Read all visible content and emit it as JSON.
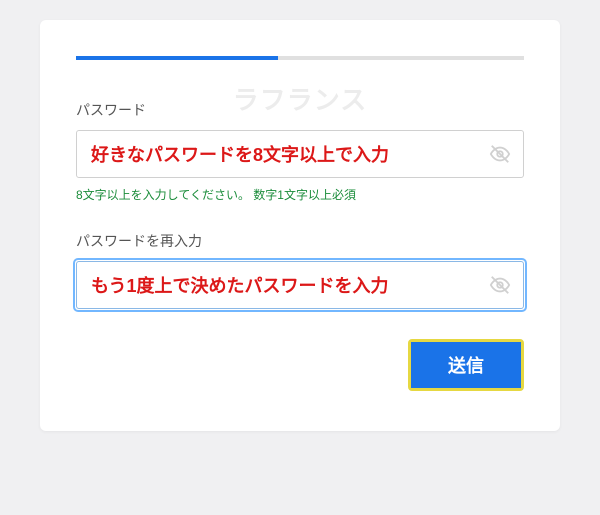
{
  "progress": {
    "percent": 45
  },
  "watermark": "ラフランス",
  "fields": {
    "password": {
      "label": "パスワード",
      "value": "好きなパスワードを8文字以上で入力",
      "helper": "8文字以上を入力してください。 数字1文字以上必須"
    },
    "password_confirm": {
      "label": "パスワードを再入力",
      "value": "もう1度上で決めたパスワードを入力"
    }
  },
  "buttons": {
    "submit": "送信"
  }
}
